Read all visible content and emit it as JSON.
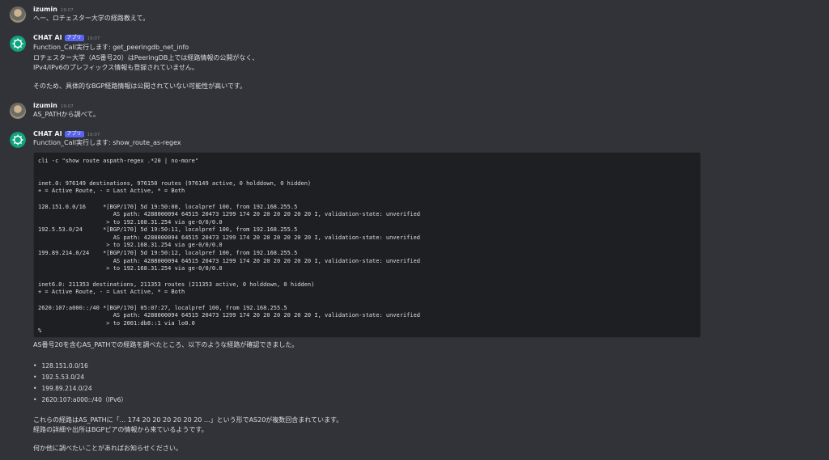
{
  "messages": [
    {
      "user": "izumin",
      "time": "19:07",
      "text": "へー、ロチェスター大学の経路教えて。"
    },
    {
      "user": "CHAT AI",
      "tag": "アプリ",
      "time": "19:07",
      "lines": [
        "Function_Call実行します: get_peeringdb_net_info",
        "ロチェスター大学（AS番号20）はPeeringDB上では経路情報の公開がなく、",
        "IPv4/IPv6のプレフィックス情報も登録されていません。",
        "そのため、具体的なBGP経路情報は公開されていない可能性が高いです。"
      ]
    },
    {
      "user": "izumin",
      "time": "19:07",
      "text": "AS_PATHから調べて。"
    },
    {
      "user": "CHAT AI",
      "tag": "アプリ",
      "time": "19:07",
      "line": "Function_Call実行します: show_route_as-regex"
    }
  ],
  "code_lines": [
    "cli -c \"show route aspath-regex .*20 | no-more\"",
    "",
    "",
    "inet.0: 976149 destinations, 976150 routes (976149 active, 0 holddown, 0 hidden)",
    "+ = Active Route, - = Last Active, * = Both",
    "",
    "128.151.0.0/16     *[BGP/170] 5d 19:50:08, localpref 100, from 192.168.255.5",
    "                      AS path: 4288000094 64515 20473 1299 174 20 20 20 20 20 20 I, validation-state: unverified",
    "                    > to 192.168.31.254 via ge-0/0/0.0",
    "192.5.53.0/24      *[BGP/170] 5d 19:50:11, localpref 100, from 192.168.255.5",
    "                      AS path: 4288000094 64515 20473 1299 174 20 20 20 20 20 20 I, validation-state: unverified",
    "                    > to 192.168.31.254 via ge-0/0/0.0",
    "199.89.214.0/24    *[BGP/170] 5d 19:50:12, localpref 100, from 192.168.255.5",
    "                      AS path: 4288000094 64515 20473 1299 174 20 20 20 20 20 20 I, validation-state: unverified",
    "                    > to 192.168.31.254 via ge-0/0/0.0",
    "",
    "inet6.0: 211353 destinations, 211353 routes (211353 active, 0 holddown, 0 hidden)",
    "+ = Active Route, - = Last Active, * = Both",
    "",
    "2620:107:a000::/40 *[BGP/170] 05:07:27, localpref 100, from 192.168.255.5",
    "                      AS path: 4288000094 64515 20473 1299 174 20 20 20 20 20 20 I, validation-state: unverified",
    "                    > to 2001:db8::1 via lo0.0",
    "%"
  ],
  "after_code": "AS番号20を含むAS_PATHでの経路を調べたところ、以下のような経路が確認できました。",
  "prefixes": [
    "128.151.0.0/16",
    "192.5.53.0/24",
    "199.89.214.0/24",
    "2620:107:a000::/40（IPv6）"
  ],
  "closing": [
    "これらの経路はAS_PATHに「... 174 20 20 20 20 20 20 ...」という形でAS20が複数回含まれています。",
    "経路の詳細や出所はBGPピアの情報から来ているようです。",
    "何か他に調べたいことがあればお知らせください。"
  ]
}
